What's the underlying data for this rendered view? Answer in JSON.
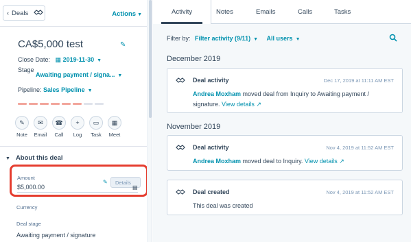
{
  "record": {
    "back_label": "Deals",
    "actions_label": "Actions",
    "title": "CA$5,000 test",
    "close_date_label": "Close Date:",
    "close_date_value": "2019-11-30",
    "stage_label": "Stage",
    "stage_value": "Awaiting payment / signa...",
    "pipeline_label": "Pipeline:",
    "pipeline_value": "Sales Pipeline",
    "activity_buttons": [
      {
        "label": "Note",
        "icon": "note-icon"
      },
      {
        "label": "Email",
        "icon": "email-icon"
      },
      {
        "label": "Call",
        "icon": "call-icon"
      },
      {
        "label": "Log",
        "icon": "log-icon"
      },
      {
        "label": "Task",
        "icon": "task-icon"
      },
      {
        "label": "Meet",
        "icon": "meet-icon"
      }
    ],
    "stage_progress": {
      "completed": 6,
      "total": 8
    }
  },
  "about": {
    "section_title": "About this deal",
    "amount_label": "Amount",
    "amount_value": "$5,000.00",
    "details_label": "Details",
    "currency_label": "Currency",
    "deal_stage_label": "Deal stage",
    "deal_stage_value": "Awaiting payment / signature"
  },
  "tabs": [
    "Activity",
    "Notes",
    "Emails",
    "Calls",
    "Tasks"
  ],
  "filter": {
    "label": "Filter by:",
    "activity_filter": "Filter activity (9/11)",
    "users_filter": "All users"
  },
  "timeline": [
    {
      "month": "December 2019",
      "title": "Deal activity",
      "date": "Dec 17, 2019 at 11:11 AM EST",
      "actor": "Andrea Moxham",
      "text": " moved deal from Inquiry to Awaiting payment / signature. ",
      "link": "View details"
    },
    {
      "month": "November 2019",
      "title": "Deal activity",
      "date": "Nov 4, 2019 at 11:52 AM EST",
      "actor": "Andrea Moxham",
      "text": " moved deal to Inquiry. ",
      "link": "View details"
    },
    {
      "title": "Deal created",
      "date": "Nov 4, 2019 at 11:52 AM EST",
      "text": "This deal was created"
    }
  ],
  "colors": {
    "accent": "#0091ae",
    "highlight": "#e53d2f",
    "progress_done": "#f2a69c",
    "progress_todo": "#dfe3eb"
  }
}
